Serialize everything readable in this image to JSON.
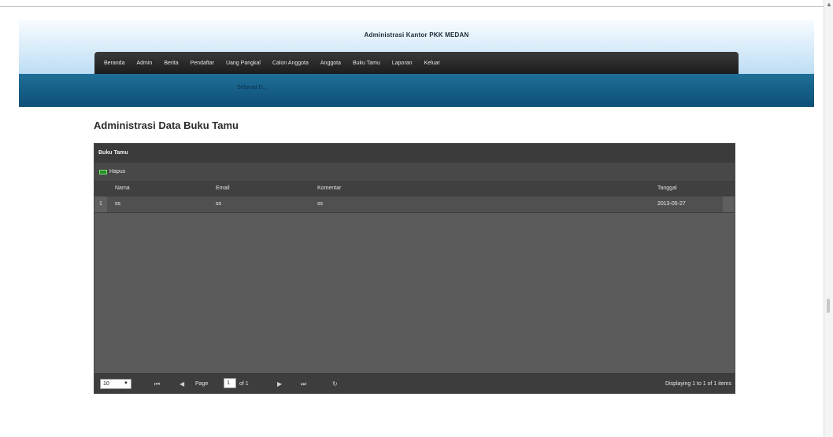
{
  "header": {
    "title": "Administrasi Kantor PKK MEDAN",
    "greeting": "Selamat D..."
  },
  "nav": {
    "items": [
      "Beranda",
      "Admin",
      "Berita",
      "Pendaftar",
      "Uang Pangkal",
      "Calon Anggota",
      "Anggota",
      "Buku Tamu",
      "Laporan",
      "Keluar"
    ]
  },
  "page": {
    "title": "Administrasi Data Buku Tamu"
  },
  "grid": {
    "title": "Buku Tamu",
    "toolbar": {
      "delete_label": "Hapus",
      "delete_icon": "minus-icon"
    },
    "columns": [
      "Nama",
      "Email",
      "Komentar",
      "Tanggal"
    ],
    "rows": [
      {
        "num": "1",
        "nama": "ss",
        "email": "ss",
        "komentar": "ss",
        "tanggal": "2013-05-27"
      }
    ],
    "pager": {
      "page_size": "10",
      "page_label": "Page",
      "page_value": "1",
      "of_label": "of 1",
      "info": "Displaying 1 to 1 of 1 items"
    }
  },
  "colors": {
    "navbar": "#2a2a2a",
    "subbar": "#14608a",
    "grid_body": "#5b5b5b"
  }
}
